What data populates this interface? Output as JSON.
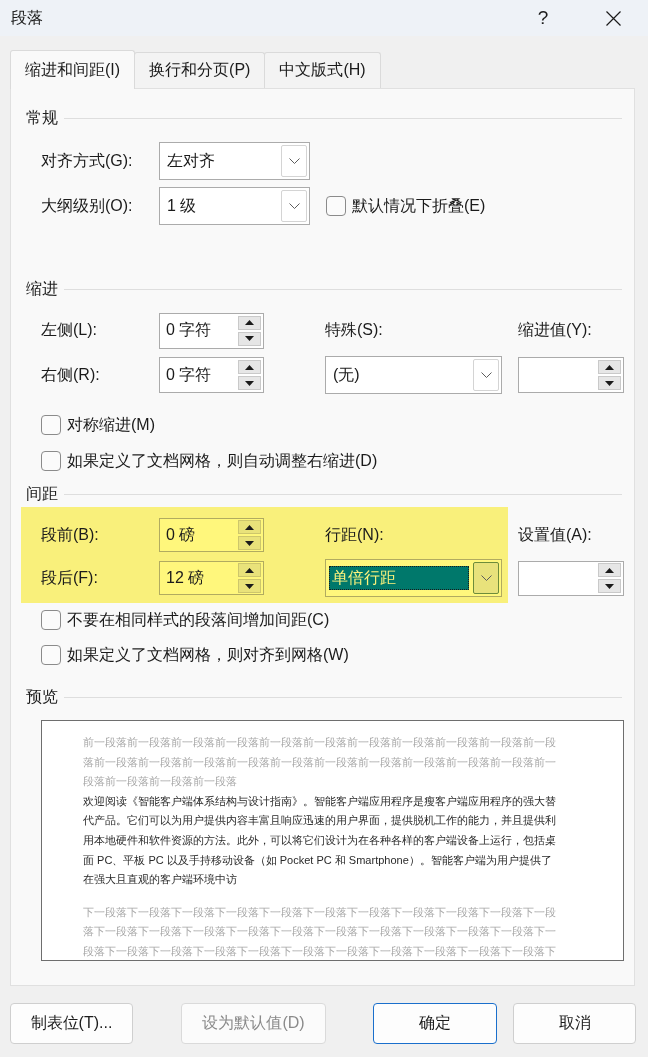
{
  "window": {
    "title": "段落",
    "help": "?"
  },
  "tabs": [
    {
      "label": "缩进和间距(I)",
      "selected": true
    },
    {
      "label": "换行和分页(P)",
      "selected": false
    },
    {
      "label": "中文版式(H)",
      "selected": false
    }
  ],
  "general": {
    "heading": "常规",
    "alignment": {
      "label": "对齐方式(G):",
      "value": "左对齐"
    },
    "outline_level": {
      "label": "大纲级别(O):",
      "value": "1 级"
    },
    "collapse_by_default": {
      "label": "默认情况下折叠(E)",
      "checked": false
    }
  },
  "indentation": {
    "heading": "缩进",
    "left": {
      "label": "左侧(L):",
      "value": "0 字符"
    },
    "right": {
      "label": "右侧(R):",
      "value": "0 字符"
    },
    "special": {
      "label": "特殊(S):",
      "value": "(无)"
    },
    "by": {
      "label": "缩进值(Y):"
    },
    "options": [
      {
        "label": "对称缩进(M)",
        "checked": false
      },
      {
        "label": "如果定义了文档网格，则自动调整右缩进(D)",
        "checked": false
      }
    ]
  },
  "spacing": {
    "heading": "间距",
    "highlighted": true,
    "before": {
      "label": "段前(B):",
      "value": "0 磅"
    },
    "after": {
      "label": "段后(F):",
      "value": "12 磅"
    },
    "line_spacing": {
      "label": "行距(N):",
      "value": "单倍行距",
      "focused": true
    },
    "at": {
      "label": "设置值(A):"
    },
    "options": [
      {
        "label": "不要在相同样式的段落间增加间距(C)",
        "checked": false
      },
      {
        "label": "如果定义了文档网格，则对齐到网格(W)",
        "checked": false
      }
    ]
  },
  "preview": {
    "heading": "预览",
    "previous_paragraph": "前一段落前一段落前一段落前一段落前一段落前一段落前一段落前一段落前一段落前一段落前一段落前一段落前一段落前一段落前一段落前一段落前一段落前一段落前一段落前一段落前一段落前一段落前一段落前一段落前一段落",
    "paragraph": "欢迎阅读《智能客户端体系结构与设计指南》。智能客户端应用程序是瘦客户端应用程序的强大替代产品。它们可以为用户提供内容丰富且响应迅速的用户界面，提供脱机工作的能力，并且提供利用本地硬件和软件资源的方法。此外，可以将它们设计为在各种各样的客户端设备上运行，包括桌面 PC、平板 PC 以及手持移动设备（如 Pocket PC 和 Smartphone）。智能客户端为用户提供了在强大且直观的客户端环境中访",
    "next_paragraph": "下一段落下一段落下一段落下一段落下一段落下一段落下一段落下一段落下一段落下一段落下一段落下一段落下一段落下一段落下一段落下一段落下一段落下一段落下一段落下一段落下一段落下一段落下一段落下一段落下一段落下一段落下一段落下一段落下一段落下一段落下一段落下一段落下"
  },
  "buttons": [
    {
      "label": "制表位(T)...",
      "default": false,
      "disabled": false
    },
    {
      "label": "设为默认值(D)",
      "default": false,
      "disabled": true
    },
    {
      "label": "确定",
      "default": true,
      "disabled": false
    },
    {
      "label": "取消",
      "default": false,
      "disabled": false
    }
  ]
}
